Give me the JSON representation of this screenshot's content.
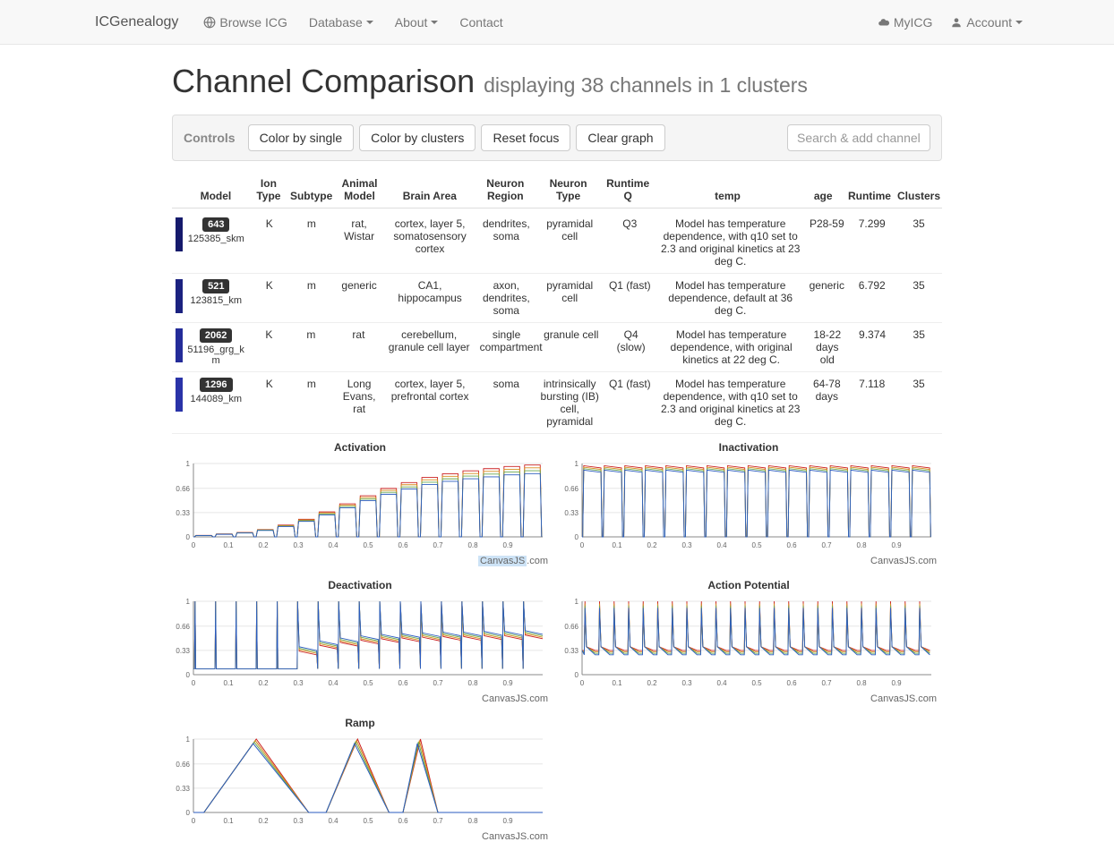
{
  "nav": {
    "brand": "ICGenealogy",
    "browse": "Browse ICG",
    "database": "Database",
    "about": "About",
    "contact": "Contact",
    "myicg": "MyICG",
    "account": "Account"
  },
  "header": {
    "title": "Channel Comparison",
    "subtitle": "displaying 38 channels in 1 clusters"
  },
  "toolbar": {
    "controls": "Controls",
    "color_single": "Color by single",
    "color_clusters": "Color by clusters",
    "reset_focus": "Reset focus",
    "clear_graph": "Clear graph",
    "search_ph": "Search & add channels"
  },
  "table": {
    "headers": {
      "model": "Model",
      "ion": "Ion Type",
      "sub": "Subtype",
      "animal": "Animal Model",
      "brain": "Brain Area",
      "region": "Neuron Region",
      "ntype": "Neuron Type",
      "rq": "Runtime Q",
      "temp": "temp",
      "age": "age",
      "rt": "Runtime",
      "clusters": "Clusters"
    },
    "rows": [
      {
        "stripe": "#151a6c",
        "badge": "643",
        "model": "125385_skm",
        "ion": "K",
        "sub": "m",
        "animal": "rat, Wistar",
        "brain": "cortex, layer 5, somatosensory cortex",
        "region": "dendrites, soma",
        "ntype": "pyramidal cell",
        "rq": "Q3",
        "temp": "Model has temperature dependence, with q10 set to 2.3 and original kinetics at 23 deg C.",
        "age": "P28-59",
        "rt": "7.299",
        "clusters": "35"
      },
      {
        "stripe": "#1b2280",
        "badge": "521",
        "model": "123815_km",
        "ion": "K",
        "sub": "m",
        "animal": "generic",
        "brain": "CA1, hippocampus",
        "region": "axon, dendrites, soma",
        "ntype": "pyramidal cell",
        "rq": "Q1 (fast)",
        "temp": "Model has temperature dependence, default at 36 deg C.",
        "age": "generic",
        "rt": "6.792",
        "clusters": "35"
      },
      {
        "stripe": "#242c99",
        "badge": "2062",
        "model": "51196_grg_km",
        "ion": "K",
        "sub": "m",
        "animal": "rat",
        "brain": "cerebellum, granule cell layer",
        "region": "single compartment",
        "ntype": "granule cell",
        "rq": "Q4 (slow)",
        "temp": "Model has temperature dependence, with original kinetics at 22 deg C.",
        "age": "18-22 days old",
        "rt": "9.374",
        "clusters": "35"
      },
      {
        "stripe": "#2a33a8",
        "badge": "1296",
        "model": "144089_km",
        "ion": "K",
        "sub": "m",
        "animal": "Long Evans, rat",
        "brain": "cortex, layer 5, prefrontal cortex",
        "region": "soma",
        "ntype": "intrinsically bursting (IB) cell, pyramidal",
        "rq": "Q1 (fast)",
        "temp": "Model has temperature dependence, with q10 set to 2.3 and original kinetics at 23 deg C.",
        "age": "64-78 days",
        "rt": "7.118",
        "clusters": "35"
      }
    ]
  },
  "charts": {
    "credit": "CanvasJS.com",
    "y_ticks": [
      0,
      0.33,
      0.66,
      1
    ],
    "x_ticks": [
      0,
      0.1,
      0.2,
      0.3,
      0.4,
      0.5,
      0.6,
      0.7,
      0.8,
      0.9
    ],
    "list": [
      {
        "title": "Activation",
        "credit_hl": true
      },
      {
        "title": "Inactivation",
        "credit_hl": false
      },
      {
        "title": "Deactivation",
        "credit_hl": false
      },
      {
        "title": "Action Potential",
        "credit_hl": false
      },
      {
        "title": "Ramp",
        "credit_hl": false
      }
    ]
  },
  "chart_data": [
    {
      "type": "line",
      "title": "Activation",
      "description": "Repeated voltage-step responses; activation curves rising in steps from ~0 to ~1 over x=0..1",
      "x_range": [
        0,
        1
      ],
      "y_range": [
        0,
        1
      ],
      "y_ticks": [
        0,
        0.35,
        0.67,
        1
      ],
      "segments": 17,
      "series": [
        {
          "name": "envelope_peak",
          "values": [
            0.02,
            0.04,
            0.06,
            0.1,
            0.16,
            0.24,
            0.34,
            0.45,
            0.56,
            0.66,
            0.74,
            0.81,
            0.86,
            0.9,
            0.93,
            0.96,
            0.98
          ]
        }
      ]
    },
    {
      "type": "line",
      "title": "Inactivation",
      "description": "Step responses quickly rising to near 1 then slightly decaying, repeated across x",
      "x_range": [
        0,
        1
      ],
      "y_range": [
        0,
        1
      ],
      "y_ticks": [
        0,
        0.29,
        0.58,
        1
      ],
      "segments": 17,
      "series": [
        {
          "name": "plateau",
          "values": [
            0.94,
            0.94,
            0.94,
            0.94,
            0.94,
            0.94,
            0.94,
            0.94,
            0.94,
            0.94,
            0.94,
            0.94,
            0.94,
            0.94,
            0.94,
            0.94,
            0.94
          ]
        }
      ]
    },
    {
      "type": "line",
      "title": "Deactivation",
      "description": "Tall narrow spikes early, then decaying tails converging to ~0.5 baseline across later segments",
      "x_range": [
        0,
        1
      ],
      "y_range": [
        0,
        1
      ],
      "y_ticks": [
        0.08,
        0.38,
        0.64,
        1
      ],
      "segments": 17,
      "series": [
        {
          "name": "tail_level",
          "values": [
            0.08,
            0.08,
            0.08,
            0.08,
            0.08,
            0.3,
            0.38,
            0.42,
            0.45,
            0.47,
            0.48,
            0.49,
            0.5,
            0.5,
            0.51,
            0.51,
            0.52
          ]
        }
      ]
    },
    {
      "type": "line",
      "title": "Action Potential",
      "description": "Repetitive spike train with roughly constant amplitude ~1 and baseline ~0.3",
      "x_range": [
        0,
        1
      ],
      "y_range": [
        0,
        1
      ],
      "y_ticks": [
        0,
        0.33,
        0.67,
        1
      ],
      "n_spikes": 24,
      "series": [
        {
          "name": "spike_peak",
          "values": [
            1.0
          ]
        },
        {
          "name": "baseline",
          "values": [
            0.33
          ]
        }
      ]
    },
    {
      "type": "line",
      "title": "Ramp",
      "description": "Three triangular pulses of decreasing width, each rising linearly to ~1 then falling to 0",
      "x_range": [
        0,
        1
      ],
      "y_range": [
        0,
        1
      ],
      "y_ticks": [
        0,
        0.33,
        0.66,
        1
      ],
      "pulses": [
        {
          "x0": 0.03,
          "xpeak": 0.18,
          "x1": 0.33,
          "peak": 1.0
        },
        {
          "x0": 0.38,
          "xpeak": 0.47,
          "x1": 0.56,
          "peak": 1.0
        },
        {
          "x0": 0.6,
          "xpeak": 0.65,
          "x1": 0.7,
          "peak": 1.0
        }
      ]
    }
  ]
}
